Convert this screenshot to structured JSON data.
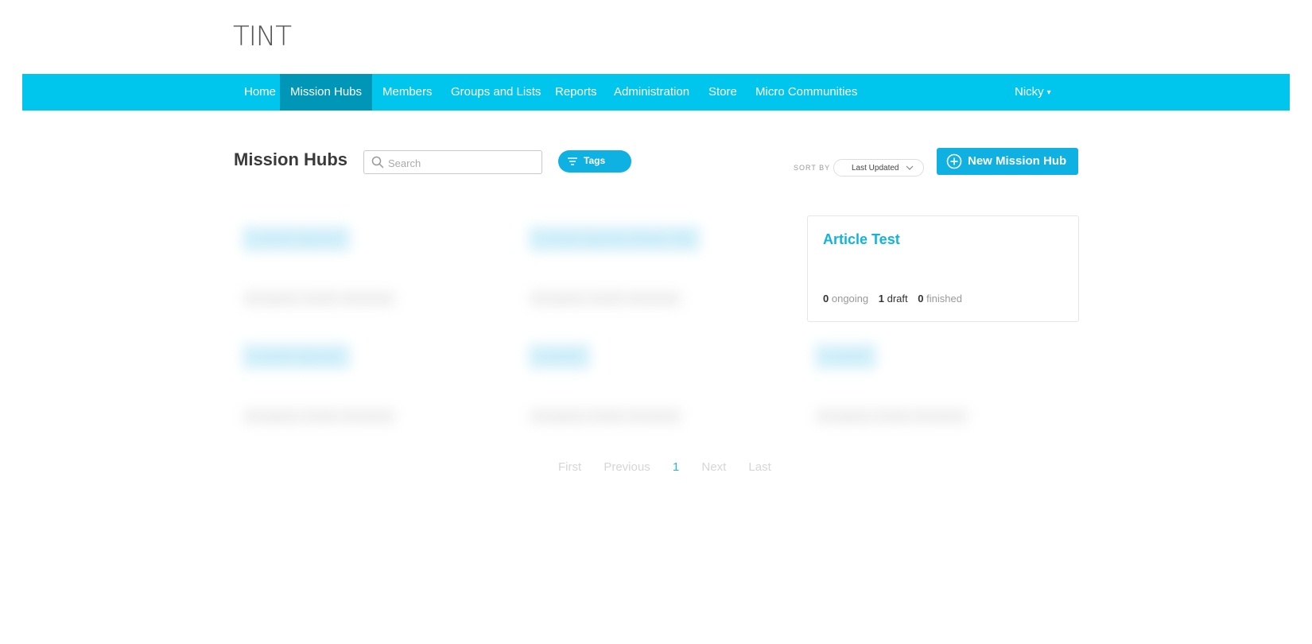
{
  "app": {
    "logo": "TINT"
  },
  "nav": {
    "items": [
      {
        "label": "Home"
      },
      {
        "label": "Mission Hubs",
        "active": true
      },
      {
        "label": "Members"
      },
      {
        "label": "Groups and Lists"
      },
      {
        "label": "Reports"
      },
      {
        "label": "Administration"
      },
      {
        "label": "Store"
      },
      {
        "label": "Micro Communities"
      }
    ],
    "user": {
      "name": "Nicky",
      "caret": "▾"
    }
  },
  "page": {
    "title": "Mission Hubs",
    "search": {
      "placeholder": "Search",
      "value": ""
    },
    "tags_label": "Tags",
    "sort": {
      "label": "SORT BY",
      "value": "Last Updated"
    },
    "new_button": "New Mission Hub"
  },
  "hubs": [
    {
      "title": "Lorem Ipsum",
      "ongoing": "0",
      "draft": "1",
      "finished": "0"
    },
    {
      "title": "Lorem Ipsum Dolor Sit",
      "ongoing": "0",
      "draft": "1",
      "finished": "0"
    },
    {
      "title": "Article Test",
      "ongoing": "0",
      "draft": "1",
      "finished": "0"
    },
    {
      "title": "Lorem Ipsum",
      "ongoing": "0",
      "draft": "1",
      "finished": "0"
    },
    {
      "title": "Lorem",
      "ongoing": "0",
      "draft": "1",
      "finished": "0"
    },
    {
      "title": "Lorem",
      "ongoing": "0",
      "draft": "1",
      "finished": "0"
    }
  ],
  "stat_labels": {
    "ongoing": "ongoing",
    "draft": "draft",
    "finished": "finished"
  },
  "pagination": {
    "first": "First",
    "previous": "Previous",
    "current": "1",
    "next": "Next",
    "last": "Last"
  },
  "colors": {
    "navbar": "#00c5ec",
    "nav_active": "#0096b8",
    "accent": "#0fb0e2",
    "hub_title": "#10b4dd"
  },
  "icons": [
    "search-icon",
    "filter-icon",
    "chevron-down-icon",
    "plus-circle-icon",
    "caret-down-icon"
  ]
}
